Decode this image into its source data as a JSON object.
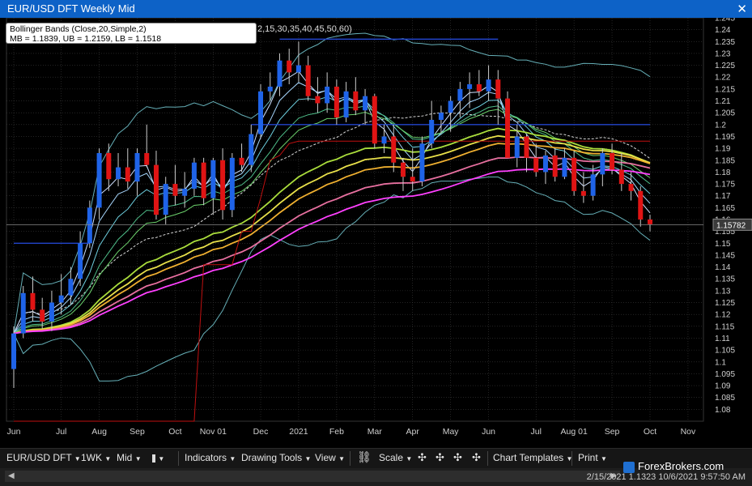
{
  "window": {
    "title": "EUR/USD DFT Weekly Mid",
    "close_glyph": "✕"
  },
  "tooltip": {
    "line1": "Bollinger Bands (Close,20,Simple,2)",
    "line2": "MB = 1.1839, UB = 1.2159, LB = 1.1518",
    "trail": "2,15,30,35,40,45,50,60)"
  },
  "price_label": "1.15782",
  "toolbar": {
    "symbol": "EUR/USD DFT",
    "interval": "1WK",
    "price_type": "Mid",
    "indicators": "Indicators",
    "drawing_tools": "Drawing Tools",
    "view": "View",
    "scale": "Scale",
    "chart_templates": "Chart Templates",
    "print": "Print",
    "dropdown_glyph": "▼"
  },
  "status": {
    "text": "2/15/2021 1.1323  10/6/2021 9:57:50 AM"
  },
  "watermark": {
    "text": "ForexBrokers.com"
  },
  "colors": {
    "up": "#1f63e8",
    "down": "#e01414",
    "grid": "#3b3b3b",
    "bb_mid": "#d6d6d6",
    "bb_band": "#66b0b8",
    "ribbon": [
      "#cfe0ff",
      "#a8d8ff",
      "#6ed0e0",
      "#4fbf8a",
      "#6dd36d",
      "#aadd3c",
      "#e8e04a",
      "#f0b030",
      "#e870a0",
      "#ff40ff"
    ],
    "sar": "#c01010",
    "hline": "#2244cc"
  },
  "chart_data": {
    "type": "candlestick",
    "title": "EUR/USD DFT Weekly Mid",
    "ylim": [
      1.075,
      1.245
    ],
    "y_ticks": [
      "1.08",
      "1.085",
      "1.09",
      "1.095",
      "1.1",
      "1.105",
      "1.11",
      "1.115",
      "1.12",
      "1.125",
      "1.13",
      "1.135",
      "1.14",
      "1.145",
      "1.15",
      "1.155",
      "1.16",
      "1.165",
      "1.17",
      "1.175",
      "1.18",
      "1.185",
      "1.19",
      "1.195",
      "1.2",
      "1.205",
      "1.21",
      "1.215",
      "1.22",
      "1.225",
      "1.23",
      "1.235",
      "1.24",
      "1.245"
    ],
    "x_labels": [
      "Jun",
      "Jul",
      "Aug",
      "Sep",
      "Oct",
      "Nov 01",
      "Dec",
      "2021",
      "Feb",
      "Mar",
      "Apr",
      "May",
      "Jun",
      "Jul",
      "Aug 01",
      "Sep",
      "Oct",
      "Nov"
    ],
    "x_label_week_index": [
      0,
      5,
      9,
      13,
      17,
      21,
      26,
      30,
      34,
      38,
      42,
      46,
      50,
      55,
      59,
      63,
      67,
      71
    ],
    "grid": true,
    "candles": [
      {
        "o": 1.097,
        "h": 1.115,
        "l": 1.089,
        "c": 1.112
      },
      {
        "o": 1.112,
        "h": 1.132,
        "l": 1.11,
        "c": 1.129
      },
      {
        "o": 1.129,
        "h": 1.136,
        "l": 1.117,
        "c": 1.122
      },
      {
        "o": 1.122,
        "h": 1.127,
        "l": 1.114,
        "c": 1.117
      },
      {
        "o": 1.117,
        "h": 1.13,
        "l": 1.113,
        "c": 1.125
      },
      {
        "o": 1.125,
        "h": 1.137,
        "l": 1.12,
        "c": 1.128
      },
      {
        "o": 1.128,
        "h": 1.14,
        "l": 1.124,
        "c": 1.135
      },
      {
        "o": 1.135,
        "h": 1.155,
        "l": 1.132,
        "c": 1.15
      },
      {
        "o": 1.15,
        "h": 1.168,
        "l": 1.148,
        "c": 1.165
      },
      {
        "o": 1.165,
        "h": 1.19,
        "l": 1.16,
        "c": 1.188
      },
      {
        "o": 1.188,
        "h": 1.192,
        "l": 1.172,
        "c": 1.177
      },
      {
        "o": 1.177,
        "h": 1.188,
        "l": 1.174,
        "c": 1.182
      },
      {
        "o": 1.182,
        "h": 1.19,
        "l": 1.173,
        "c": 1.176
      },
      {
        "o": 1.176,
        "h": 1.19,
        "l": 1.17,
        "c": 1.188
      },
      {
        "o": 1.188,
        "h": 1.2,
        "l": 1.182,
        "c": 1.183
      },
      {
        "o": 1.183,
        "h": 1.189,
        "l": 1.16,
        "c": 1.162
      },
      {
        "o": 1.162,
        "h": 1.178,
        "l": 1.158,
        "c": 1.175
      },
      {
        "o": 1.175,
        "h": 1.183,
        "l": 1.166,
        "c": 1.17
      },
      {
        "o": 1.17,
        "h": 1.18,
        "l": 1.165,
        "c": 1.173
      },
      {
        "o": 1.173,
        "h": 1.186,
        "l": 1.17,
        "c": 1.184
      },
      {
        "o": 1.184,
        "h": 1.186,
        "l": 1.166,
        "c": 1.169
      },
      {
        "o": 1.169,
        "h": 1.186,
        "l": 1.162,
        "c": 1.185
      },
      {
        "o": 1.185,
        "h": 1.19,
        "l": 1.16,
        "c": 1.164
      },
      {
        "o": 1.164,
        "h": 1.188,
        "l": 1.161,
        "c": 1.186
      },
      {
        "o": 1.186,
        "h": 1.192,
        "l": 1.18,
        "c": 1.183
      },
      {
        "o": 1.183,
        "h": 1.2,
        "l": 1.18,
        "c": 1.196
      },
      {
        "o": 1.196,
        "h": 1.217,
        "l": 1.194,
        "c": 1.214
      },
      {
        "o": 1.214,
        "h": 1.222,
        "l": 1.21,
        "c": 1.216
      },
      {
        "o": 1.216,
        "h": 1.23,
        "l": 1.212,
        "c": 1.227
      },
      {
        "o": 1.227,
        "h": 1.232,
        "l": 1.217,
        "c": 1.222
      },
      {
        "o": 1.222,
        "h": 1.235,
        "l": 1.218,
        "c": 1.225
      },
      {
        "o": 1.225,
        "h": 1.229,
        "l": 1.21,
        "c": 1.212
      },
      {
        "o": 1.212,
        "h": 1.22,
        "l": 1.205,
        "c": 1.209
      },
      {
        "o": 1.209,
        "h": 1.222,
        "l": 1.205,
        "c": 1.216
      },
      {
        "o": 1.216,
        "h": 1.219,
        "l": 1.2,
        "c": 1.203
      },
      {
        "o": 1.203,
        "h": 1.218,
        "l": 1.201,
        "c": 1.214
      },
      {
        "o": 1.214,
        "h": 1.22,
        "l": 1.204,
        "c": 1.206
      },
      {
        "o": 1.206,
        "h": 1.215,
        "l": 1.2,
        "c": 1.212
      },
      {
        "o": 1.212,
        "h": 1.213,
        "l": 1.19,
        "c": 1.192
      },
      {
        "o": 1.192,
        "h": 1.2,
        "l": 1.188,
        "c": 1.195
      },
      {
        "o": 1.195,
        "h": 1.2,
        "l": 1.18,
        "c": 1.184
      },
      {
        "o": 1.184,
        "h": 1.186,
        "l": 1.172,
        "c": 1.178
      },
      {
        "o": 1.178,
        "h": 1.19,
        "l": 1.172,
        "c": 1.176
      },
      {
        "o": 1.176,
        "h": 1.195,
        "l": 1.174,
        "c": 1.192
      },
      {
        "o": 1.192,
        "h": 1.21,
        "l": 1.19,
        "c": 1.202
      },
      {
        "o": 1.202,
        "h": 1.208,
        "l": 1.196,
        "c": 1.205
      },
      {
        "o": 1.205,
        "h": 1.212,
        "l": 1.197,
        "c": 1.21
      },
      {
        "o": 1.21,
        "h": 1.218,
        "l": 1.203,
        "c": 1.215
      },
      {
        "o": 1.215,
        "h": 1.222,
        "l": 1.207,
        "c": 1.217
      },
      {
        "o": 1.217,
        "h": 1.223,
        "l": 1.212,
        "c": 1.214
      },
      {
        "o": 1.214,
        "h": 1.225,
        "l": 1.21,
        "c": 1.219
      },
      {
        "o": 1.219,
        "h": 1.223,
        "l": 1.2,
        "c": 1.211
      },
      {
        "o": 1.211,
        "h": 1.214,
        "l": 1.19,
        "c": 1.186
      },
      {
        "o": 1.186,
        "h": 1.2,
        "l": 1.182,
        "c": 1.195
      },
      {
        "o": 1.195,
        "h": 1.196,
        "l": 1.18,
        "c": 1.186
      },
      {
        "o": 1.186,
        "h": 1.192,
        "l": 1.178,
        "c": 1.18
      },
      {
        "o": 1.18,
        "h": 1.189,
        "l": 1.175,
        "c": 1.187
      },
      {
        "o": 1.187,
        "h": 1.19,
        "l": 1.176,
        "c": 1.178
      },
      {
        "o": 1.178,
        "h": 1.19,
        "l": 1.177,
        "c": 1.186
      },
      {
        "o": 1.186,
        "h": 1.189,
        "l": 1.17,
        "c": 1.172
      },
      {
        "o": 1.172,
        "h": 1.18,
        "l": 1.167,
        "c": 1.17
      },
      {
        "o": 1.17,
        "h": 1.183,
        "l": 1.168,
        "c": 1.179
      },
      {
        "o": 1.179,
        "h": 1.19,
        "l": 1.174,
        "c": 1.188
      },
      {
        "o": 1.188,
        "h": 1.192,
        "l": 1.179,
        "c": 1.181
      },
      {
        "o": 1.181,
        "h": 1.188,
        "l": 1.172,
        "c": 1.175
      },
      {
        "o": 1.175,
        "h": 1.18,
        "l": 1.168,
        "c": 1.172
      },
      {
        "o": 1.172,
        "h": 1.174,
        "l": 1.157,
        "c": 1.16
      },
      {
        "o": 1.16,
        "h": 1.162,
        "l": 1.155,
        "c": 1.158
      }
    ],
    "series": [
      {
        "period": 3,
        "color": "#cfe0ff"
      },
      {
        "period": 5,
        "color": "#a8d8ff"
      },
      {
        "period": 8,
        "color": "#6ed0e0"
      },
      {
        "period": 12,
        "color": "#4fbf8a"
      },
      {
        "period": 15,
        "color": "#6dd36d"
      },
      {
        "period": 30,
        "color": "#aadd3c"
      },
      {
        "period": 35,
        "color": "#e8e04a"
      },
      {
        "period": 40,
        "color": "#f0b030"
      },
      {
        "period": 50,
        "color": "#e870a0"
      },
      {
        "period": 60,
        "color": "#ff40ff"
      }
    ],
    "bollinger": {
      "period": 20,
      "stdev": 2
    },
    "hlines": [
      {
        "y": 1.15,
        "from": 0,
        "to": 8
      },
      {
        "y": 1.2,
        "from": 25,
        "to": 67
      },
      {
        "y": 1.236,
        "from": 28,
        "to": 51
      }
    ],
    "current_price": 1.15782
  }
}
